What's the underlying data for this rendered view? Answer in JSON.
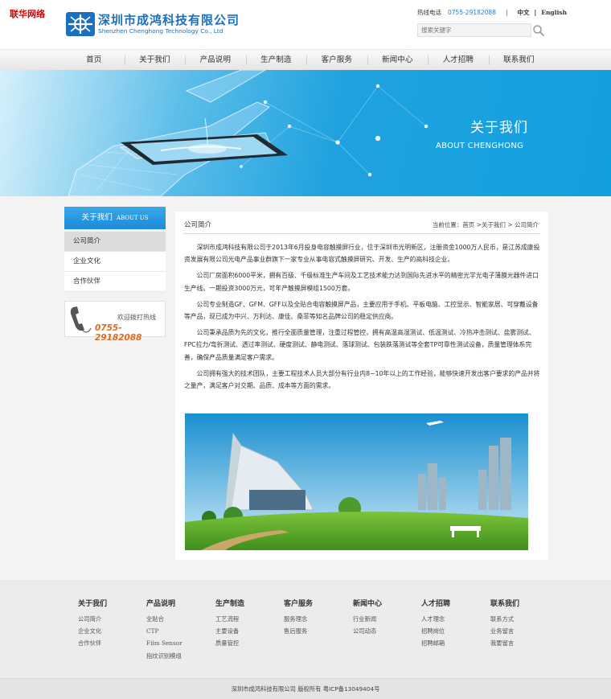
{
  "corner_tag": "联华网络",
  "header": {
    "company_cn": "深圳市成鸿科技有限公司",
    "company_en": "Shenzhen Chenghong Technology Co., Ltd",
    "hotline_label": "热线电话",
    "hotline_number": "0755-29182088",
    "separator": "|",
    "lang_cn": "中文",
    "lang_divider": "|",
    "lang_en": "English",
    "search_placeholder": "搜索关键字",
    "search_icon": "search-icon"
  },
  "nav": {
    "items": [
      "首页",
      "关于我们",
      "产品说明",
      "生产制造",
      "客户服务",
      "新闻中心",
      "人才招聘",
      "联系我们"
    ]
  },
  "banner": {
    "title_cn": "关于我们",
    "title_en": "ABOUT CHENGHONG"
  },
  "sidebar": {
    "title_cn": "关于我们",
    "title_en": "ABOUT US",
    "items": [
      "公司简介",
      "企业文化",
      "合作伙伴"
    ],
    "active_index": 0,
    "hotline_label": "欢迎拨打热线",
    "hotline_number": "0755-29182088",
    "hotline_icon": "phone-icon"
  },
  "main": {
    "heading": "公司简介",
    "breadcrumb": "当前位置：首页 >关于我们 > 公司简介",
    "paragraphs": [
      "深圳市成鸿科技有限公司于2013年6月投身电容触摸屏行业，位于深圳市光明新区，注册资金1000万人民币，是江苏成康投资发展有限公司光电产品事业群旗下一家专业从事电容式触摸屏研究、开发、生产的高科技企业。",
      "公司厂房面积6000平米，拥有百级、千级标准生产车间及工艺技术能力达到国际先进水平的精密光学光电子薄膜元器件进口生产线。一期投资3000万元，可年产触摸屏模组1500万套。",
      "公司专业制造GF、GFM、GFF以及全贴合电容触摸屏产品，主要应用于手机、平板电脑、工控显示、智能家居、可穿戴设备等产品，现已成为中兴、万利达、康佳、桑菲等知名品牌公司的稳定供应商。",
      "公司秉承品质为先的文化，推行全面质量管理，注重过程管控，拥有高温高湿测试、低温测试、冷热冲击测试、盐雾测试、FPC拉力/弯折测试、透过率测试、硬度测试、静电测试、落球测试、包装跌落测试等全套TP可靠性测试设备，质量管理体系完善，确保产品质量满足客户需求。",
      "公司拥有强大的技术团队，主要工程技术人员大部分有行业内8~10年以上的工作经验，能够快速开发出客户要求的产品并将之量产，满足客户对交期、品质、成本等方面的需求。"
    ]
  },
  "footer": {
    "columns": [
      {
        "title": "关于我们",
        "links": [
          "公司简介",
          "企业文化",
          "合作伙伴"
        ]
      },
      {
        "title": "产品说明",
        "links": [
          "全贴合",
          "CTP",
          "Film Sensor",
          "指纹识别模组"
        ]
      },
      {
        "title": "生产制造",
        "links": [
          "工艺流程",
          "主要设备",
          "质量管控"
        ]
      },
      {
        "title": "客户服务",
        "links": [
          "服务理念",
          "售后服务"
        ]
      },
      {
        "title": "新闻中心",
        "links": [
          "行业新闻",
          "公司动态"
        ]
      },
      {
        "title": "人才招聘",
        "links": [
          "人才理念",
          "招聘岗位",
          "招聘邮箱"
        ]
      },
      {
        "title": "联系我们",
        "links": [
          "联系方式",
          "业务留言",
          "我要留言"
        ]
      }
    ],
    "copyright": "深圳市成鸿科技有限公司  版权所有  粤ICP备13049404号"
  },
  "colors": {
    "brand_blue": "#1b6fc0",
    "accent_blue": "#1fa2df",
    "hotline_orange": "#e06a1b",
    "corner_red": "#d40000"
  }
}
